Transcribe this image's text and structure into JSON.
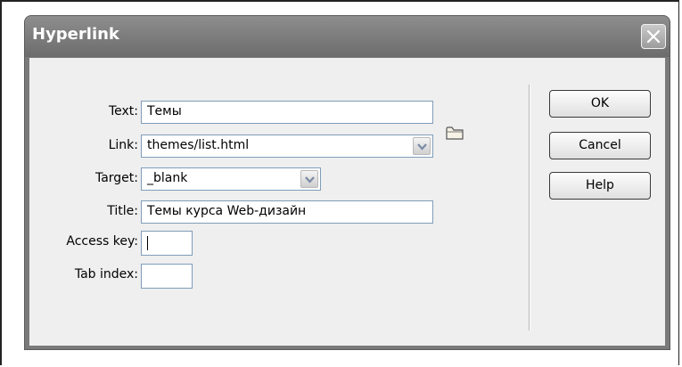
{
  "dialog": {
    "title": "Hyperlink",
    "close_icon": "close-icon"
  },
  "form": {
    "text": {
      "label": "Text:",
      "value": "Темы"
    },
    "link": {
      "label": "Link:",
      "value": "themes/list.html",
      "browse_icon": "folder-icon"
    },
    "target": {
      "label": "Target:",
      "value": "_blank"
    },
    "title": {
      "label": "Title:",
      "value": "Темы курса Web-дизайн"
    },
    "access_key": {
      "label": "Access key:",
      "value": ""
    },
    "tab_index": {
      "label": "Tab index:",
      "value": ""
    }
  },
  "buttons": {
    "ok": "OK",
    "cancel": "Cancel",
    "help": "Help"
  }
}
